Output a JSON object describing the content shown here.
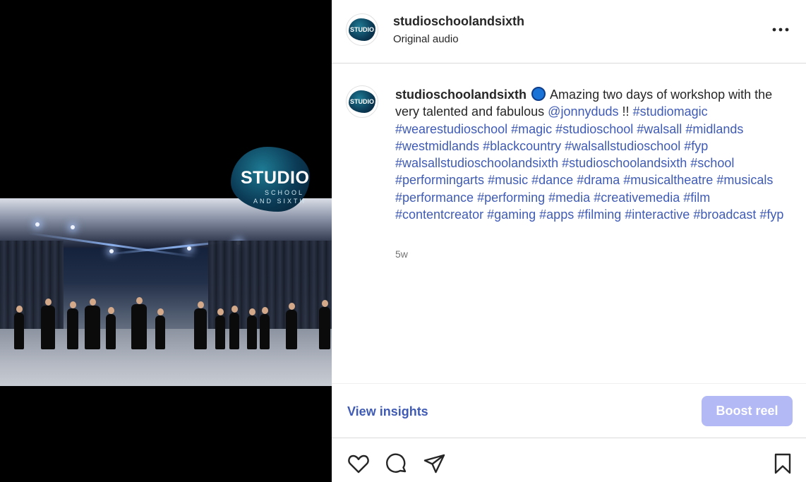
{
  "post": {
    "username": "studioschoolandsixth",
    "audio": "Original audio",
    "avatar_text": "STUDIO"
  },
  "logo": {
    "line1": "STUDIO",
    "line2": "SCHOOL",
    "line3": "AND SIXTH"
  },
  "caption": {
    "username": "studioschoolandsixth",
    "text1": "Amazing two days of workshop with the very talented and fabulous",
    "mention": "@jonnyduds",
    "text2": "!!",
    "hashtags": [
      "#studiomagic",
      "#wearestudioschool",
      "#magic",
      "#studioschool",
      "#walsall",
      "#midlands",
      "#westmidlands",
      "#blackcountry",
      "#walsallstudioschool",
      "#fyp",
      "#walsallstudioschoolandsixth",
      "#studioschoolandsixth",
      "#school",
      "#performingarts",
      "#music",
      "#dance",
      "#drama",
      "#musicaltheatre",
      "#musicals",
      "#performance",
      "#performing",
      "#media",
      "#creativemedia",
      "#film",
      "#contentcreator",
      "#gaming",
      "#apps",
      "#filming",
      "#interactive",
      "#broadcast",
      "#fyp"
    ],
    "time": "5w"
  },
  "actions": {
    "view_insights": "View insights",
    "boost": "Boost reel"
  },
  "icons": {
    "more": "more-options-icon",
    "like": "heart-icon",
    "comment": "comment-icon",
    "share": "send-icon",
    "save": "bookmark-icon"
  },
  "colors": {
    "link": "#3f5bb5",
    "boost_bg": "#b3b9f5",
    "emoji": "#1a73d6"
  }
}
